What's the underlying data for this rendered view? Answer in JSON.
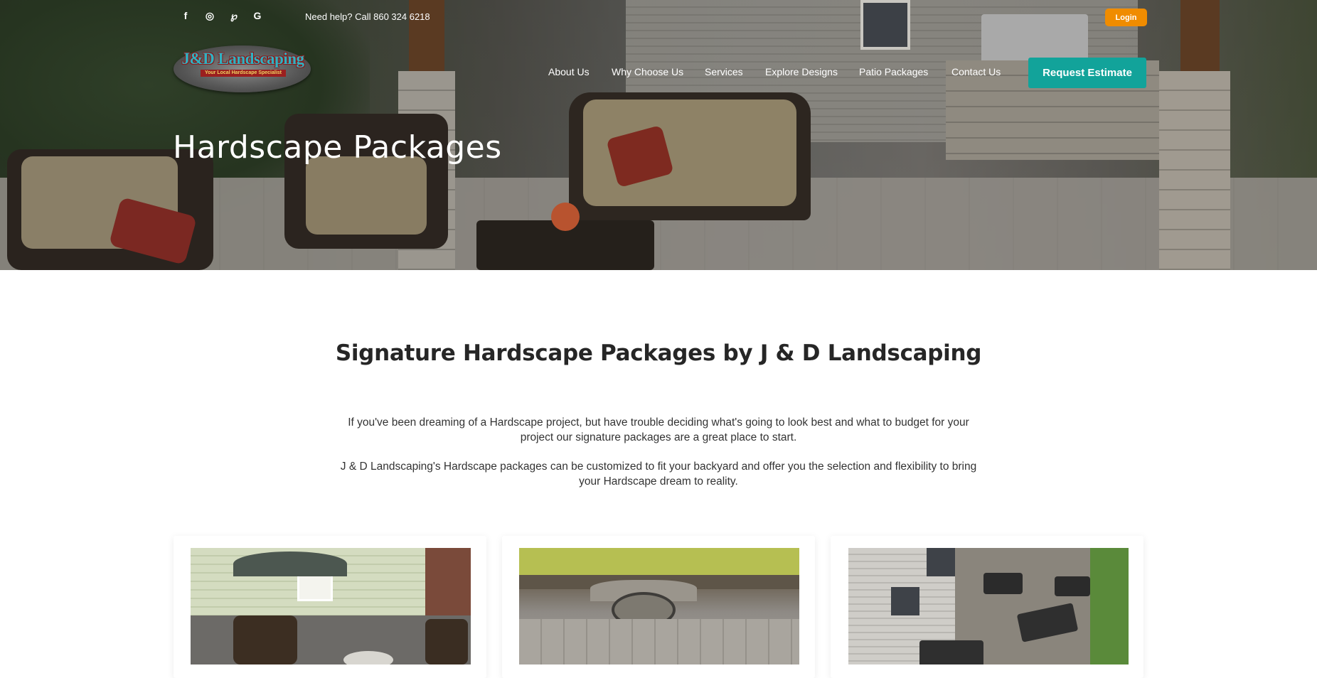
{
  "topbar": {
    "social_icons": [
      "facebook-icon",
      "instagram-icon",
      "pinterest-icon",
      "google-icon"
    ],
    "social_glyphs": [
      "f",
      "◎",
      "℘",
      "G"
    ],
    "help_text": "Need help? Call 860 324 6218",
    "login_label": "Login"
  },
  "logo": {
    "name": "J&D Landscaping",
    "tagline": "Your Local Hardscape Specialist"
  },
  "nav": {
    "items": [
      "About Us",
      "Why Choose Us",
      "Services",
      "Explore Designs",
      "Patio Packages",
      "Contact Us"
    ],
    "cta_label": "Request Estimate"
  },
  "hero": {
    "title": "Hardscape Packages"
  },
  "main": {
    "heading": "Signature Hardscape Packages by J & D Landscaping",
    "paragraphs": [
      "If you've been dreaming of a Hardscape project, but have trouble deciding what's going to look best and what to budget for your project our signature packages are a great place to start.",
      "J & D Landscaping's Hardscape packages can be customized to fit your backyard and offer you the selection and flexibility to bring your Hardscape dream to reality."
    ]
  },
  "colors": {
    "accent": "#12a39a",
    "login": "#f08c00"
  }
}
